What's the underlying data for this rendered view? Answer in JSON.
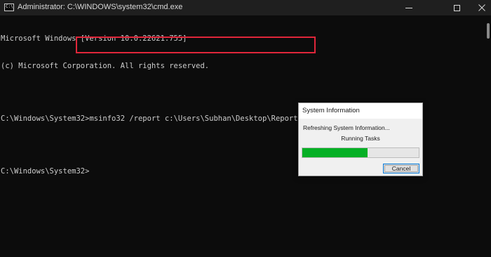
{
  "window": {
    "title": "Administrator: C:\\WINDOWS\\system32\\cmd.exe",
    "icon_text": "C:\\"
  },
  "console": {
    "lines": [
      "Microsoft Windows [Version 10.0.22621.755]",
      "(c) Microsoft Corporation. All rights reserved."
    ],
    "prompt1": "C:\\Windows\\System32>",
    "command": "msinfo32 /report c:\\Users\\Subhan\\Desktop\\ReportSample.txt",
    "prompt2": "C:\\Windows\\System32>"
  },
  "dialog": {
    "title": "System Information",
    "status": "Refreshing System Information...",
    "task": "Running Tasks",
    "progress_fraction": 0.56,
    "cancel_label": "Cancel"
  },
  "colors": {
    "console_bg": "#0c0c0c",
    "console_text": "#cccccc",
    "highlight_border": "#e0263a",
    "progress_green": "#06b025"
  },
  "icons": {
    "minimize": "minimize-icon",
    "maximize": "maximize-icon",
    "close": "close-icon"
  }
}
